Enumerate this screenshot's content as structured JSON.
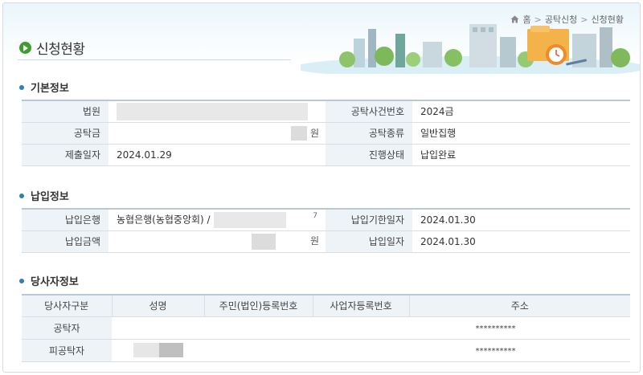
{
  "header": {
    "page_title": "신청현황",
    "breadcrumb": [
      "홈",
      "공탁신청",
      "신청현황"
    ],
    "breadcrumb_sep": ">"
  },
  "sections": {
    "basic": {
      "title": "기본정보",
      "rows": [
        {
          "l1": "법원",
          "v1": "",
          "l2": "공탁사건번호",
          "v2": "2024금"
        },
        {
          "l1": "공탁금",
          "v1": "",
          "unit1": "원",
          "l2": "공탁종류",
          "v2": "일반집행"
        },
        {
          "l1": "제출일자",
          "v1": "2024.01.29",
          "l2": "진행상태",
          "v2": "납입완료"
        }
      ]
    },
    "payment": {
      "title": "납입정보",
      "rows": [
        {
          "l1": "납입은행",
          "v1": "농협은행(농협중앙회)  /",
          "suffix1": "7",
          "l2": "납입기한일자",
          "v2": "2024.01.30"
        },
        {
          "l1": "납입금액",
          "v1": "",
          "unit1": "원",
          "l2": "납입일자",
          "v2": "2024.01.30"
        }
      ]
    },
    "party": {
      "title": "당사자정보",
      "columns": [
        "당사자구분",
        "성명",
        "주민(법인)등록번호",
        "사업자등록번호",
        "주소"
      ],
      "rows": [
        {
          "type": "공탁자",
          "name": "",
          "id": "",
          "biz": "",
          "addr": "**********"
        },
        {
          "type": "피공탁자",
          "name": "",
          "id": "",
          "biz": "",
          "addr": "**********"
        }
      ]
    }
  },
  "colors": {
    "accent_green": "#3f9c2f",
    "bullet_blue": "#2c7fb8",
    "header_cell_bg": "#eef3f7"
  },
  "icons": {
    "home": "home-icon",
    "title_arrow": "play-circle-icon"
  }
}
